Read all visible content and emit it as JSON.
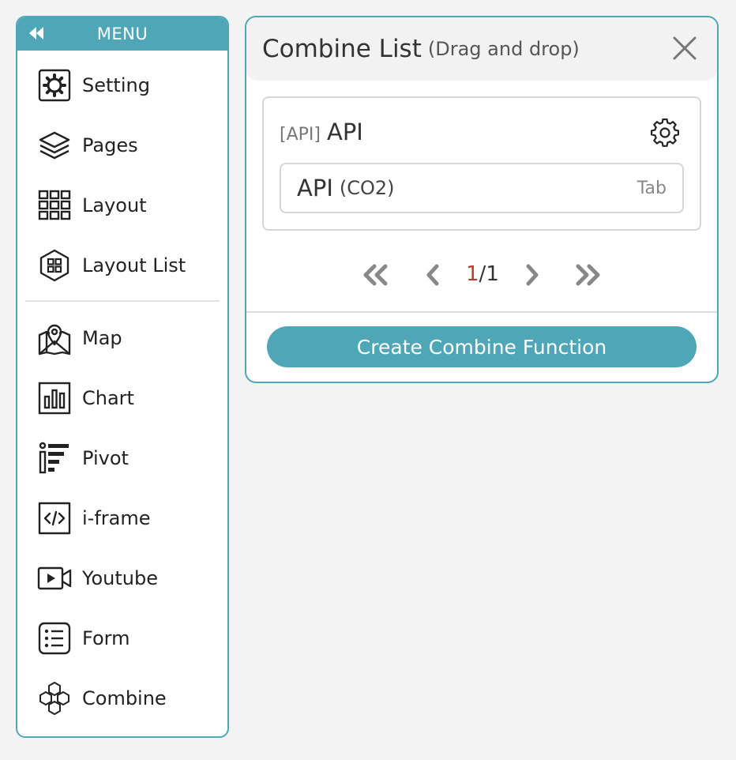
{
  "menu": {
    "header": "MENU",
    "items": [
      {
        "label": "Setting",
        "icon": "gear-icon"
      },
      {
        "label": "Pages",
        "icon": "layers-icon"
      },
      {
        "label": "Layout",
        "icon": "grid-icon"
      },
      {
        "label": "Layout List",
        "icon": "hexagon-grid-icon"
      },
      {
        "label": "Map",
        "icon": "map-pin-icon"
      },
      {
        "label": "Chart",
        "icon": "bar-chart-icon"
      },
      {
        "label": "Pivot",
        "icon": "pivot-icon"
      },
      {
        "label": "i-frame",
        "icon": "code-icon"
      },
      {
        "label": "Youtube",
        "icon": "video-icon"
      },
      {
        "label": "Form",
        "icon": "form-list-icon"
      },
      {
        "label": "Combine",
        "icon": "hexagons-icon"
      }
    ]
  },
  "panel": {
    "title": "Combine List",
    "subtitle": "(Drag and drop)",
    "card": {
      "tag": "[API]",
      "name": "API",
      "item": {
        "name": "API",
        "sub": "(CO2)",
        "tab": "Tab"
      }
    },
    "pagination": {
      "current": "1",
      "separator": "/",
      "total": "1"
    },
    "create_button": "Create Combine Function"
  },
  "colors": {
    "accent": "#4ea6b6",
    "current_page": "#c0392b"
  }
}
